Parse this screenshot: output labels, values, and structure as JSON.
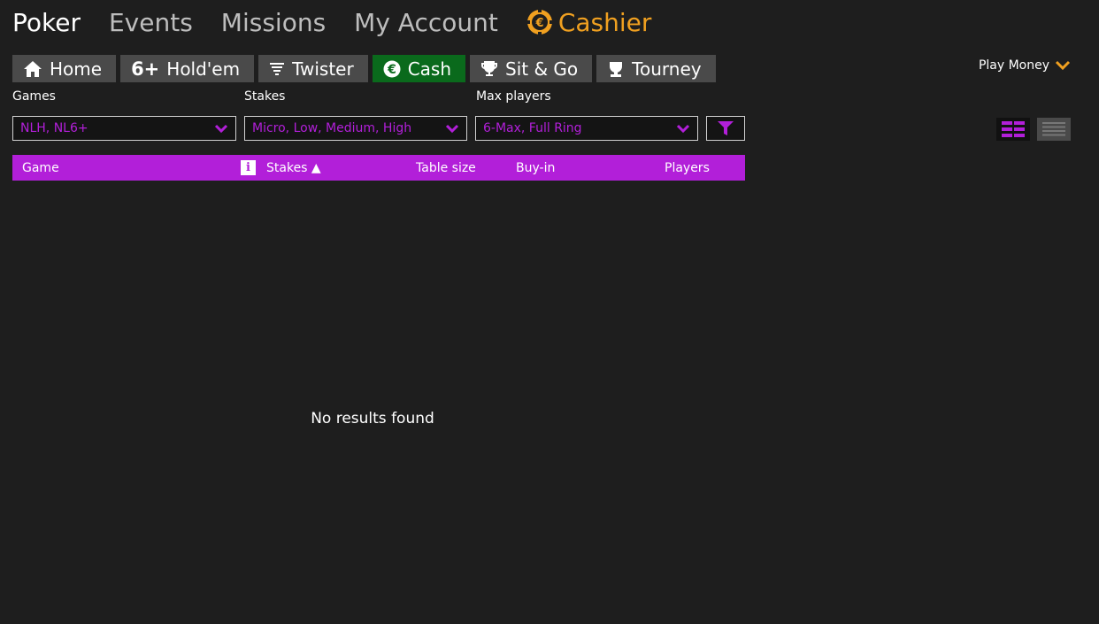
{
  "top_nav": {
    "items": [
      "Poker",
      "Events",
      "Missions",
      "My Account"
    ],
    "cashier": "Cashier"
  },
  "tabs": [
    {
      "label": "Home",
      "icon": "home-icon"
    },
    {
      "label": "Hold'em",
      "icon_text": "6+"
    },
    {
      "label": "Twister",
      "icon": "twister-icon"
    },
    {
      "label": "Cash",
      "icon": "euro-icon",
      "active": true
    },
    {
      "label": "Sit & Go",
      "icon": "trophy-icon"
    },
    {
      "label": "Tourney",
      "icon": "cup-icon"
    }
  ],
  "play_mode": "Play Money",
  "filters": {
    "games_label": "Games",
    "games_value": "NLH, NL6+",
    "stakes_label": "Stakes",
    "stakes_value": "Micro, Low, Medium, High",
    "max_players_label": "Max players",
    "max_players_value": "6-Max, Full Ring"
  },
  "table": {
    "columns": {
      "game": "Game",
      "stakes": "Stakes ▲",
      "table_size": "Table size",
      "buy_in": "Buy-in",
      "players": "Players"
    },
    "info_icon": "i",
    "empty_message": "No results found"
  },
  "colors": {
    "accent": "#b21fd9",
    "cashier": "#f0a020",
    "active_tab": "#0a6a1c",
    "background": "#1e1e1e"
  }
}
